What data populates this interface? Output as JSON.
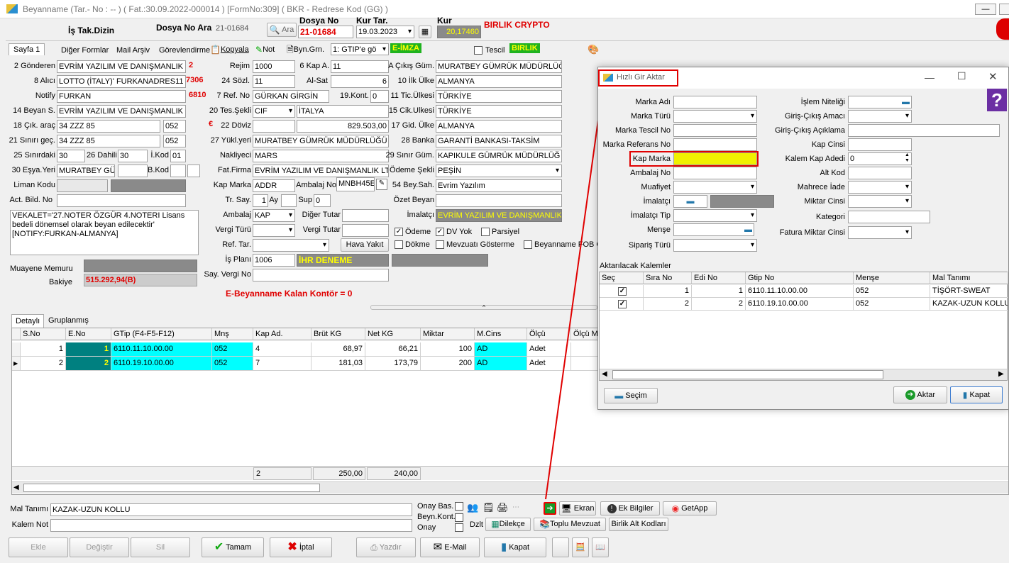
{
  "window": {
    "title": "Beyanname (Tar.- No : -- ) ( Fat.:30.09.2022-000014 ) [FormNo:309] ( BKR - Redrese Kod (GG) )"
  },
  "header": {
    "is_takip": "İş Tak.Dizin",
    "dosya_no_ara_label": "Dosya No Ara",
    "dosya_no_ara_value": "21-01684",
    "ara_button": "Ara",
    "dosya_no_label": "Dosya No",
    "dosya_no_value": "21-01684",
    "kur_tar_label": "Kur Tar.",
    "kur_tar_value": "19.03.2023",
    "kur_label": "Kur",
    "kur_value": "20,17460",
    "company": "BIRLIK CRYPTO"
  },
  "toolbar": {
    "tabs": [
      "Sayfa 1",
      "Diğer Formlar",
      "Mail Arşiv",
      "Görevlendirme"
    ],
    "kopyala": "Kopyala",
    "not": "Not",
    "byn_grn": "Byn.Grn.",
    "gtip_select": "1: GTIP'e gö",
    "e_imza": "E-İMZA",
    "tescil": "Tescil",
    "birlik": "BIRLIK"
  },
  "left_fields": [
    {
      "label": "2 Gönderen",
      "value": "EVRİM YAZILIM VE DANIŞMANLIK L",
      "extra": "2"
    },
    {
      "label": "8 Alıcı",
      "value": "LOTTO (İTALY)' FURKANADRES11",
      "extra": "7306"
    },
    {
      "label": "Notify",
      "value": "FURKAN",
      "extra": "6810"
    },
    {
      "label": "14 Beyan S.",
      "value": "EVRİM YAZILIM VE DANIŞMANLIK"
    },
    {
      "label": "18 Çık. araç",
      "value": "34 ZZZ 85",
      "code": "052"
    },
    {
      "label": "21 Sınırı geç.",
      "value": "34 ZZZ 85",
      "code": "052"
    }
  ],
  "row25": {
    "label25": "25 Sınırdaki",
    "v25": "30",
    "label26": "26 Dahili",
    "v26": "30",
    "ikod_label": "İ.Kod",
    "ikod": "01"
  },
  "row30": {
    "label": "30 Eşya.Yeri",
    "value": "MURATBEY GÜ",
    "bkod_label": "B.Kod"
  },
  "liman_label": "Liman Kodu",
  "act_label": "Act. Bild. No",
  "vekalet_text": "VEKALET='27.NOTER ÖZGÜR 4.NOTERI Lisans bedeli dönemsel olarak beyan edilecektir' [NOTIFY:FURKAN-ALMANYA]",
  "muayene_label": "Muayene Memuru",
  "bakiye_label": "Bakiye",
  "bakiye_value": "515.292,94(B)",
  "mid_fields": {
    "rejim_label": "Rejim",
    "rejim": "1000",
    "kapa_label": "6 Kap A.",
    "kapa": "11",
    "sozl_label": "24 Sözl.",
    "sozl": "11",
    "alsat_label": "Al-Sat",
    "alsat": "6",
    "refno_label": "7 Ref. No",
    "refno": "GÜRKAN GİRGİN",
    "kont_label": "19.Kont.",
    "kont": "0",
    "tes_label": "20 Tes.Şekli",
    "tes": "CIF",
    "tes_country": "İTALYA",
    "euro": "€",
    "doviz_label": "22 Döviz",
    "doviz": "829.503,00",
    "yukl_label": "27 Yükl.yeri",
    "yukl": "MURATBEY GÜMRÜK MÜDÜRLÜĞÜ",
    "naklyeci_label": "Nakliyeci",
    "naklyeci": "MARS",
    "fatfirma_label": "Fat.Firma",
    "fatfirma": "EVRİM YAZILIM VE DANIŞMANLIK LT",
    "kapmarka_label": "Kap Marka",
    "kapmarka": "ADDR",
    "ambalajno_label": "Ambalaj No",
    "ambalajno": "MNBH45E",
    "trsay_label": "Tr. Say.",
    "trsay": "1",
    "ay_label": "Ay",
    "sup_label": "Sup",
    "sup": "0",
    "ambalaj_label": "Ambalaj",
    "ambalaj": "KAP",
    "diger_label": "Diğer Tutar",
    "vergiturk_label": "Vergi Türü",
    "vergitutar_label": "Vergi Tutar",
    "reftar_label": "Ref. Tar.",
    "hava_button": "Hava Yakıt",
    "isplani_label": "İş Planı",
    "isplani": "1006",
    "ihr": "İHR DENEME",
    "sayvergi_label": "Say. Vergi No",
    "kontor": "E-Beyanname Kalan Kontör = 0"
  },
  "right_fields": {
    "cikis_label": "A Çıkış Güm.",
    "cikis": "MURATBEY GÜMRÜK MÜDÜRLÜĞ",
    "ilk_label": "10 İlk Ülke",
    "ilk": "ALMANYA",
    "tic_label": "11 Tic.Ülkesi",
    "tic": "TÜRKİYE",
    "cik_label": "15 Cik.Ulkesi",
    "cik": "TÜRKİYE",
    "gid_label": "17 Gid. Ülke",
    "gid": "ALMANYA",
    "banka_label": "28 Banka",
    "banka": "GARANTİ BANKASI-TAKSİM",
    "sinir_label": "29 Sınır Güm.",
    "sinir": "KAPIKULE GÜMRÜK MÜDÜRLÜĞ",
    "odeme_label": "Ödeme Şekli",
    "odeme": "PEŞİN",
    "beysah_label": "54 Bey.Sah.",
    "beysah": "Evrim Yazılım",
    "ozet_label": "Özet Beyan",
    "imalatci_label": "İmalatçı",
    "imalatci": "EVRİM YAZILIM VE DANIŞMANLIK",
    "chk_odeme": "Ödeme",
    "chk_dvyok": "DV Yok",
    "chk_parsiyel": "Parsiyel",
    "chk_dokme": "Dökme",
    "chk_mevzuat": "Mevzuatı Gösterme",
    "chk_fob": "Beyanname FOB G"
  },
  "detail_tabs": [
    "Detaylı",
    "Gruplanmış"
  ],
  "detail_grid": {
    "columns": [
      "S.No",
      "E.No",
      "GTip (F4-F5-F12)",
      "Mnş",
      "Kap Ad.",
      "Brüt KG",
      "Net KG",
      "Miktar",
      "M.Cins",
      "Ölçü",
      "Ölçü M"
    ],
    "rows": [
      [
        "1",
        "1",
        "6110.11.10.00.00",
        "052",
        "4",
        "68,97",
        "66,21",
        "100",
        "AD",
        "Adet",
        ""
      ],
      [
        "2",
        "2",
        "6110.19.10.00.00",
        "052",
        "7",
        "181,03",
        "173,79",
        "200",
        "AD",
        "Adet",
        ""
      ]
    ],
    "totals": {
      "kap": "2",
      "brut": "250,00",
      "net": "240,00"
    }
  },
  "bottom": {
    "mal_tanimi_label": "Mal Tanımı",
    "mal_tanimi": "KAZAK-UZUN KOLLU",
    "kalem_not_label": "Kalem Not",
    "onay_bas": "Onay Bas.",
    "beyn_kont": "Beyn.Kont.",
    "onay": "Onay",
    "ekran": "Ekran",
    "ek_bilgiler": "Ek Bilgiler",
    "getapp": "GetApp",
    "dzlt": "Dzlt",
    "dilekce": "Dilekçe",
    "toplu_mevzuat": "Toplu Mevzuat",
    "birlik_alt": "Birlik Alt Kodları",
    "ekle": "Ekle",
    "degistir": "Değiştir",
    "sil": "Sil",
    "tamam": "Tamam",
    "iptal": "İptal",
    "yazdir": "Yazdır",
    "email": "E-Mail",
    "kapat": "Kapat"
  },
  "dialog": {
    "title": "Hızlı Gir Aktar",
    "left_labels": [
      "Marka Adı",
      "Marka Türü",
      "Marka Tescil No",
      "Marka Referans No",
      "Kap Marka",
      "Ambalaj No",
      "Muafiyet",
      "İmalatçı",
      "İmalatçı Tip",
      "Menşe",
      "Sipariş Türü"
    ],
    "right_labels": [
      "İşlem Niteliği",
      "Giriş-Çıkış Amacı",
      "Giriş-Çıkış Açıklama",
      "Kap Cinsi",
      "Kalem Kap Adedi",
      "Alt Kod",
      "Mahrece İade",
      "Miktar Cinsi",
      "Kategori",
      "Fatura Miktar Cinsi"
    ],
    "kalem_kap_adedi": "0",
    "aktarilacak_label": "Aktarılacak Kalemler",
    "columns": [
      "Seç",
      "Sıra No",
      "Edi No",
      "Gtip No",
      "Menşe",
      "Mal Tanımı"
    ],
    "rows": [
      [
        "✓",
        "1",
        "1",
        "6110.11.10.00.00",
        "052",
        "TİŞÖRT-SWEAT"
      ],
      [
        "✓",
        "2",
        "2",
        "6110.19.10.00.00",
        "052",
        "KAZAK-UZUN KOLLU"
      ]
    ],
    "secim": "Seçim",
    "aktar": "Aktar",
    "kapat": "Kapat"
  },
  "colors": {
    "accent_red": "#e00000",
    "cyan": "#00ffff",
    "teal": "#008080",
    "yellow": "#f0f000",
    "green_badge": "#1fb31f"
  }
}
